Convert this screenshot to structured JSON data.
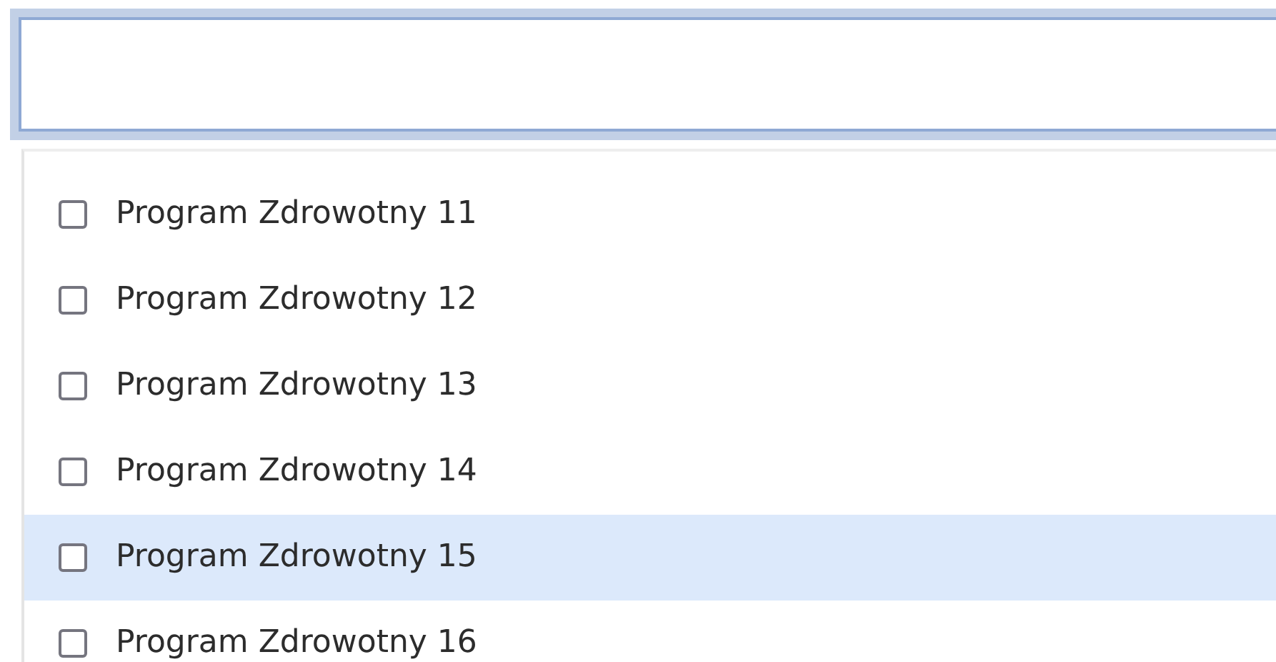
{
  "search_field": {
    "focused": true
  },
  "options": [
    {
      "label": "Program Zdrowotny 11",
      "checked": false,
      "highlighted": false
    },
    {
      "label": "Program Zdrowotny 12",
      "checked": false,
      "highlighted": false
    },
    {
      "label": "Program Zdrowotny 13",
      "checked": false,
      "highlighted": false
    },
    {
      "label": "Program Zdrowotny 14",
      "checked": false,
      "highlighted": false
    },
    {
      "label": "Program Zdrowotny 15",
      "checked": false,
      "highlighted": true
    },
    {
      "label": "Program Zdrowotny 16",
      "checked": false,
      "highlighted": false
    }
  ]
}
